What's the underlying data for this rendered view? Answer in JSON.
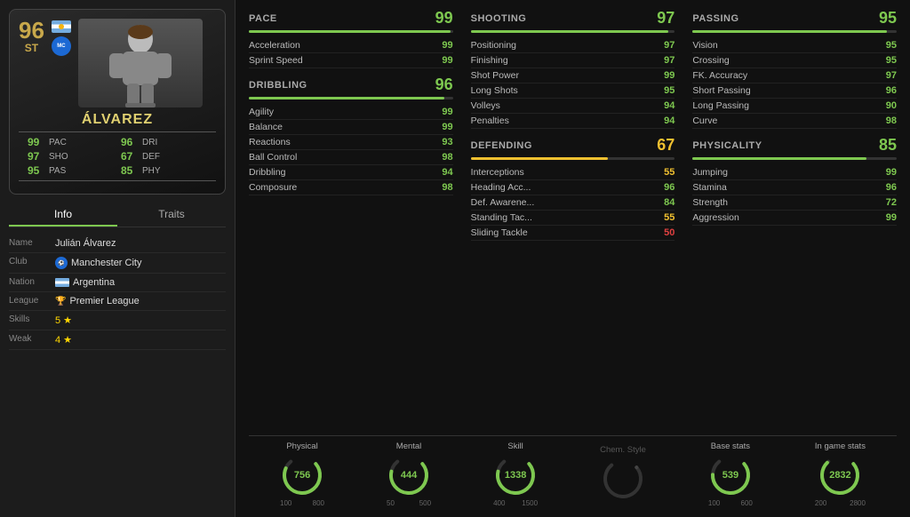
{
  "player": {
    "rating": "96",
    "position": "ST",
    "name": "ÁLVAREZ",
    "full_name": "Julián Álvarez"
  },
  "card_stats": [
    {
      "label": "PAC",
      "value": "99"
    },
    {
      "label": "DRI",
      "value": "96"
    },
    {
      "label": "SHO",
      "value": "97"
    },
    {
      "label": "DEF",
      "value": "67"
    },
    {
      "label": "PAS",
      "value": "95"
    },
    {
      "label": "PHY",
      "value": "85"
    }
  ],
  "tabs": {
    "active": "Info",
    "inactive": "Traits"
  },
  "info": {
    "name_label": "Name",
    "name_value": "Julián Álvarez",
    "club_label": "Club",
    "club_value": "Manchester City",
    "nation_label": "Nation",
    "nation_value": "Argentina",
    "league_label": "League",
    "league_value": "Premier League",
    "skills_label": "Skills",
    "skills_value": "5 ★",
    "weak_label": "Weak"
  },
  "pace": {
    "category": "PACE",
    "overall": "99",
    "bar_pct": 99,
    "color": "green",
    "stats": [
      {
        "name": "Acceleration",
        "value": "99",
        "color": "green"
      },
      {
        "name": "Sprint Speed",
        "value": "99",
        "color": "green"
      }
    ]
  },
  "shooting": {
    "category": "SHOOTING",
    "overall": "97",
    "bar_pct": 97,
    "color": "green",
    "stats": [
      {
        "name": "Positioning",
        "value": "97",
        "color": "green"
      },
      {
        "name": "Finishing",
        "value": "97",
        "color": "green"
      },
      {
        "name": "Shot Power",
        "value": "99",
        "color": "green"
      },
      {
        "name": "Long Shots",
        "value": "95",
        "color": "green"
      },
      {
        "name": "Volleys",
        "value": "94",
        "color": "green"
      },
      {
        "name": "Penalties",
        "value": "94",
        "color": "green"
      }
    ]
  },
  "passing": {
    "category": "PASSING",
    "overall": "95",
    "bar_pct": 95,
    "color": "green",
    "stats": [
      {
        "name": "Vision",
        "value": "95",
        "color": "green"
      },
      {
        "name": "Crossing",
        "value": "95",
        "color": "green"
      },
      {
        "name": "FK. Accuracy",
        "value": "97",
        "color": "green"
      },
      {
        "name": "Short Passing",
        "value": "96",
        "color": "green"
      },
      {
        "name": "Long Passing",
        "value": "90",
        "color": "green"
      },
      {
        "name": "Curve",
        "value": "98",
        "color": "green"
      }
    ]
  },
  "dribbling": {
    "category": "DRIBBLING",
    "overall": "96",
    "bar_pct": 96,
    "color": "green",
    "stats": [
      {
        "name": "Agility",
        "value": "99",
        "color": "green"
      },
      {
        "name": "Balance",
        "value": "99",
        "color": "green"
      },
      {
        "name": "Reactions",
        "value": "93",
        "color": "green"
      },
      {
        "name": "Ball Control",
        "value": "98",
        "color": "green"
      },
      {
        "name": "Dribbling",
        "value": "94",
        "color": "green"
      },
      {
        "name": "Composure",
        "value": "98",
        "color": "green"
      }
    ]
  },
  "defending": {
    "category": "DEFENDING",
    "overall": "67",
    "bar_pct": 67,
    "color": "yellow",
    "stats": [
      {
        "name": "Interceptions",
        "value": "55",
        "color": "yellow"
      },
      {
        "name": "Heading Acc...",
        "value": "96",
        "color": "green"
      },
      {
        "name": "Def. Awarene...",
        "value": "84",
        "color": "green"
      },
      {
        "name": "Standing Tac...",
        "value": "55",
        "color": "yellow"
      },
      {
        "name": "Sliding Tackle",
        "value": "50",
        "color": "red"
      }
    ]
  },
  "physicality": {
    "category": "PHYSICALITY",
    "overall": "85",
    "bar_pct": 85,
    "color": "green",
    "stats": [
      {
        "name": "Jumping",
        "value": "99",
        "color": "green"
      },
      {
        "name": "Stamina",
        "value": "96",
        "color": "green"
      },
      {
        "name": "Strength",
        "value": "72",
        "color": "green"
      },
      {
        "name": "Aggression",
        "value": "99",
        "color": "green"
      }
    ]
  },
  "gauges": [
    {
      "label": "Physical",
      "value": "756",
      "min": "100",
      "max": "800",
      "pct": 90
    },
    {
      "label": "Mental",
      "value": "444",
      "min": "50",
      "max": "500",
      "pct": 86
    },
    {
      "label": "Skill",
      "value": "1338",
      "min": "400",
      "max": "1500",
      "pct": 86
    },
    {
      "label": "Chem. Style",
      "value": "",
      "min": "",
      "max": "",
      "pct": 0,
      "dim": true
    },
    {
      "label": "Base stats",
      "value": "539",
      "min": "100",
      "max": "600",
      "pct": 82
    },
    {
      "label": "In game stats",
      "value": "2832",
      "min": "200",
      "max": "2800",
      "pct": 98
    }
  ]
}
